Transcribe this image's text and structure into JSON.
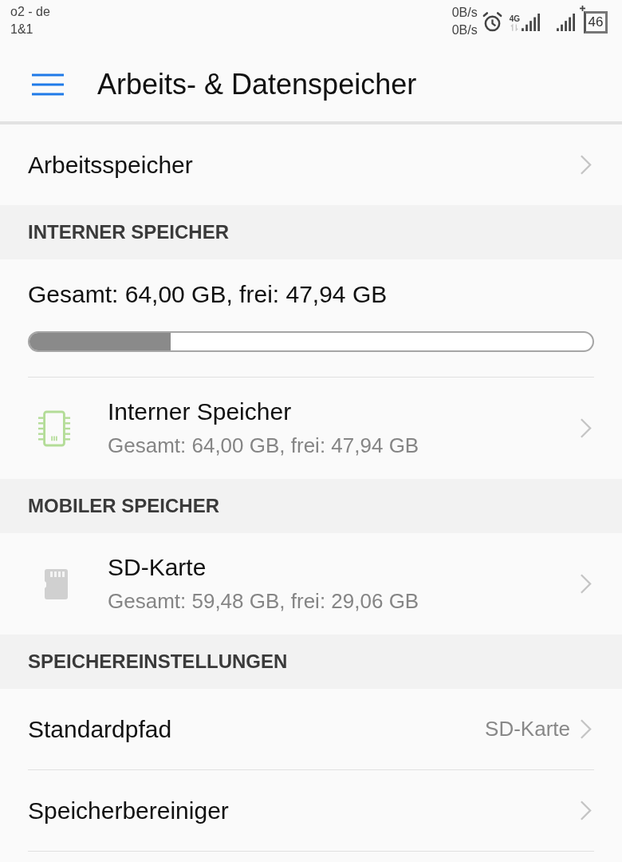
{
  "status_bar": {
    "carrier_lines": [
      "o2 - de",
      "1&1"
    ],
    "speed_lines": [
      "0B/s",
      "0B/s"
    ],
    "network_type": "4G",
    "battery": "46"
  },
  "app_bar": {
    "title": "Arbeits- & Datenspeicher"
  },
  "sections": [
    {
      "items": [
        {
          "kind": "link",
          "title": "Arbeitsspeicher"
        }
      ]
    },
    {
      "header": "INTERNER SPEICHER",
      "items": [
        {
          "kind": "usage",
          "summary": "Gesamt: 64,00 GB, frei: 47,94 GB",
          "level": 0.25
        },
        {
          "kind": "internal",
          "title": "Interner Speicher",
          "subtitle": "Gesamt: 64,00 GB, frei: 47,94 GB"
        }
      ]
    },
    {
      "header": "MOBILER SPEICHER",
      "items": [
        {
          "kind": "sd_card",
          "title": "SD-Karte",
          "subtitle": "Gesamt: 59,48 GB, frei: 29,06 GB"
        }
      ]
    },
    {
      "header": "SPEICHEREINSTELLUNGEN",
      "items": [
        {
          "kind": "link",
          "title": "Standardpfad",
          "value": "SD-Karte"
        },
        {
          "kind": "link",
          "title": "Speicherbereiniger"
        }
      ]
    }
  ]
}
